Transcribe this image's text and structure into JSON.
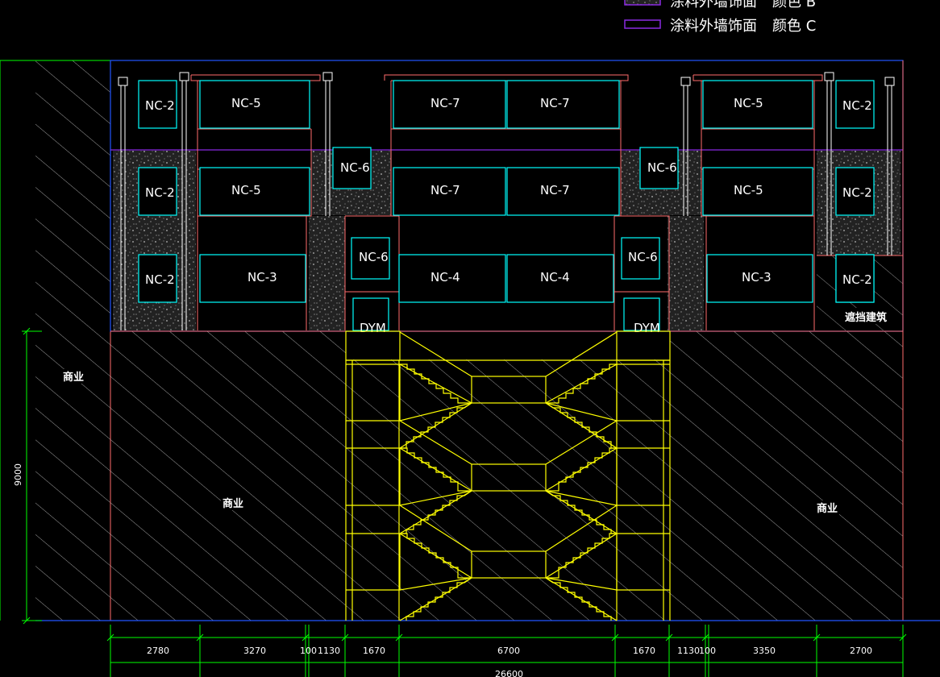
{
  "legend": {
    "row1_name": "涂料外墙饰面",
    "row1_color": "颜色 B",
    "row2_name": "涂料外墙饰面",
    "row2_color": "颜色 C"
  },
  "windows": {
    "nc2": "NC-2",
    "nc3": "NC-3",
    "nc4": "NC-4",
    "nc5": "NC-5",
    "nc6": "NC-6",
    "nc7": "NC-7",
    "dym": "DYM"
  },
  "labels": {
    "commerce": "商业",
    "blocking": "遮挡建筑"
  },
  "dimensions": {
    "height": "9000",
    "segments": [
      "2780",
      "3270",
      "100",
      "1130",
      "1670",
      "6700",
      "1670",
      "1130",
      "100",
      "3350",
      "2700"
    ],
    "total": "26600"
  },
  "colors": {
    "background": "#000000",
    "window": "#00ffff",
    "wall": "#ff6b6b",
    "frame": "#2255ff",
    "stair": "#ffff00",
    "dimension": "#00ff00",
    "hatch": "#c8c8c8",
    "band": "#8a2be2"
  }
}
